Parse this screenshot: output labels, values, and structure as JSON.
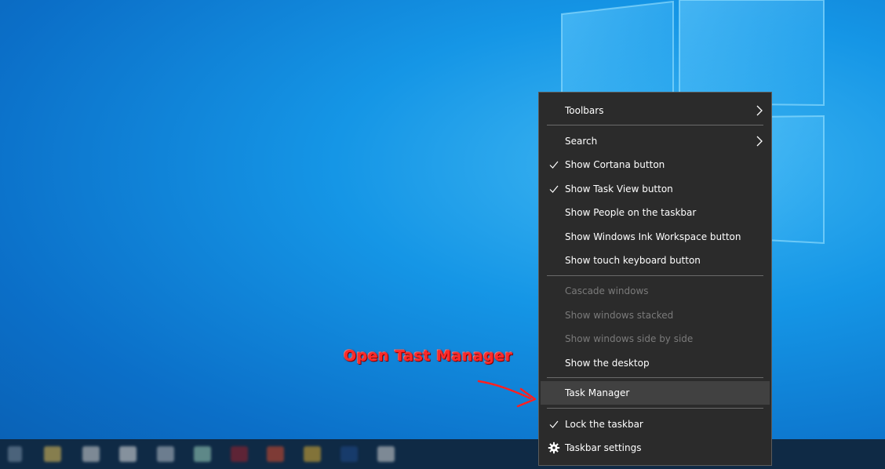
{
  "context_menu": {
    "items": [
      {
        "label": "Toolbars",
        "checked": false,
        "submenu": true,
        "disabled": false
      },
      {
        "label": "Search",
        "checked": false,
        "submenu": true,
        "disabled": false
      },
      {
        "label": "Show Cortana button",
        "checked": true,
        "submenu": false,
        "disabled": false
      },
      {
        "label": "Show Task View button",
        "checked": true,
        "submenu": false,
        "disabled": false
      },
      {
        "label": "Show People on the taskbar",
        "checked": false,
        "submenu": false,
        "disabled": false
      },
      {
        "label": "Show Windows Ink Workspace button",
        "checked": false,
        "submenu": false,
        "disabled": false
      },
      {
        "label": "Show touch keyboard button",
        "checked": false,
        "submenu": false,
        "disabled": false
      },
      {
        "label": "Cascade windows",
        "checked": false,
        "submenu": false,
        "disabled": true
      },
      {
        "label": "Show windows stacked",
        "checked": false,
        "submenu": false,
        "disabled": true
      },
      {
        "label": "Show windows side by side",
        "checked": false,
        "submenu": false,
        "disabled": true
      },
      {
        "label": "Show the desktop",
        "checked": false,
        "submenu": false,
        "disabled": false
      },
      {
        "label": "Task Manager",
        "checked": false,
        "submenu": false,
        "disabled": false,
        "highlighted": true
      },
      {
        "label": "Lock the taskbar",
        "checked": true,
        "submenu": false,
        "disabled": false
      },
      {
        "label": "Taskbar settings",
        "checked": false,
        "submenu": false,
        "disabled": false,
        "icon": "gear-icon"
      }
    ]
  },
  "annotation": {
    "text": "Open Tast Manager",
    "color": "#ff2a2a"
  },
  "colors": {
    "menu_background": "#2b2b2b",
    "menu_hover": "#414141",
    "menu_text": "#ffffff",
    "menu_disabled_text": "#7a7a7a",
    "desktop_blue": "#1596e6",
    "taskbar": "#0f2a45"
  },
  "icons": {
    "check": "check-icon",
    "submenu": "chevron-right-icon",
    "settings": "gear-icon",
    "windows_logo": "windows-logo"
  }
}
